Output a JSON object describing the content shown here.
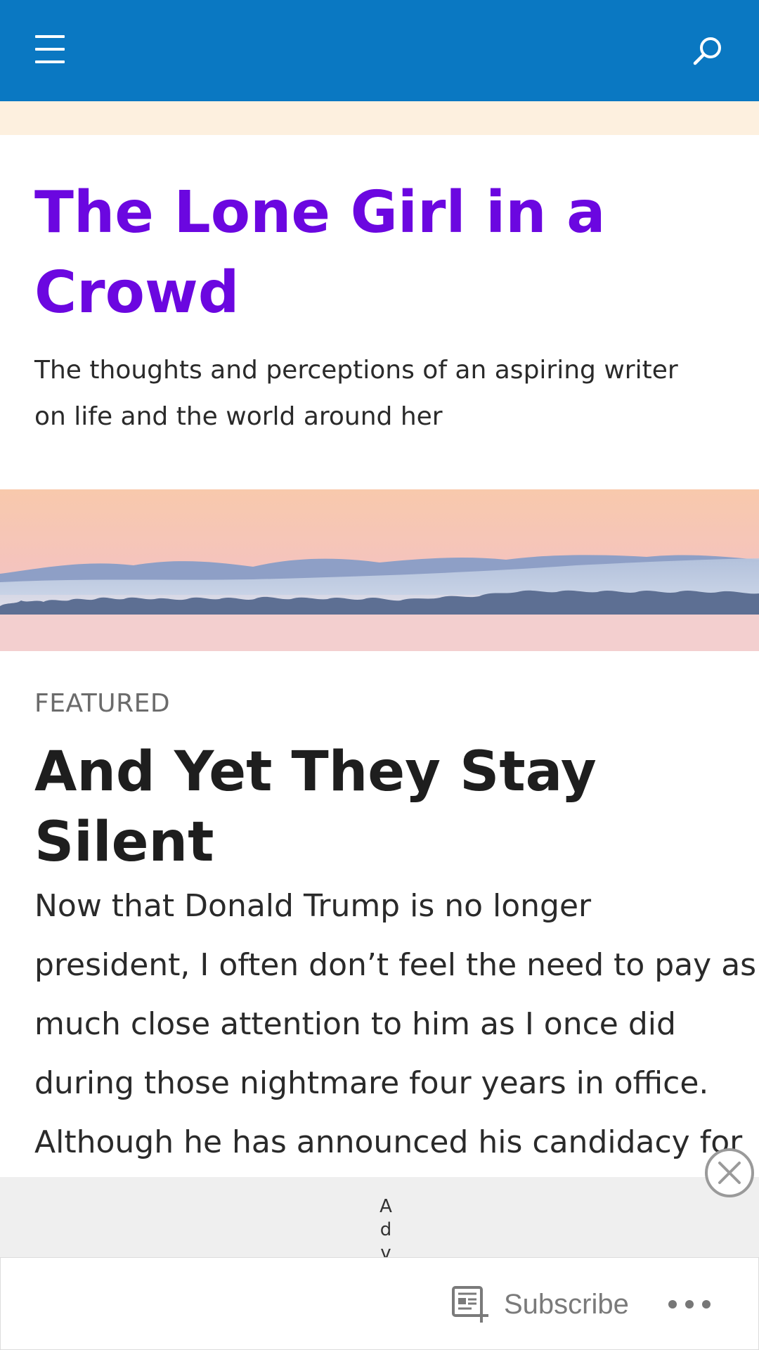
{
  "site": {
    "title": "The Lone Girl in a Crowd",
    "description": "The thoughts and perceptions of an aspiring writer on life and the world around her"
  },
  "topbar": {
    "menu_icon": "hamburger-menu-icon",
    "search_icon": "search-icon",
    "background_color": "#0a78c2"
  },
  "post": {
    "category": "FEATURED",
    "title": "And Yet They Stay Silent",
    "excerpt_lines": [
      "Now that Donald Trump is no longer",
      "president, I often don’t feel the need to pay as",
      "much close attention to him as I once did",
      "during those nightmare four years in office.",
      "Although he has announced his candidacy for"
    ]
  },
  "ad": {
    "label": "Adve",
    "close_icon": "close-circle-icon"
  },
  "action_bar": {
    "subscribe_label": "Subscribe",
    "subscribe_icon": "reader-subscribe-icon",
    "more_icon": "more-dots-icon"
  },
  "colors": {
    "title_purple": "#6b07e0",
    "text_dark": "#1e1e1e",
    "category_grey": "#6b6b6b"
  }
}
